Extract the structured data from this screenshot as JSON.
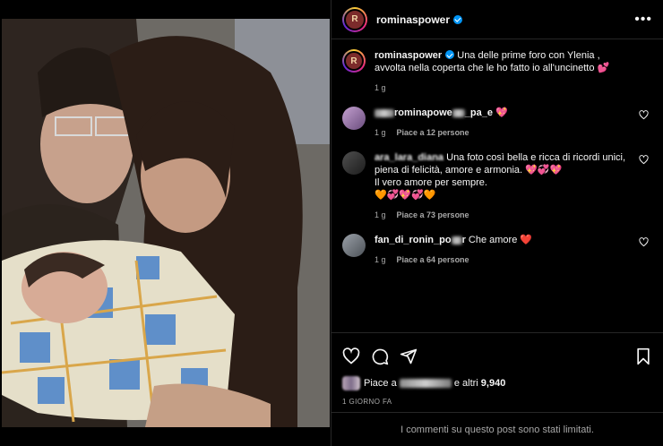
{
  "post": {
    "username": "rominaspower",
    "avatar_text": "R",
    "caption": "Una delle prime foro con Ylenia , avvolta nella coperta che le ho fatto io all'uncinetto 💕",
    "caption_time": "1 g"
  },
  "comments": [
    {
      "username_visible": "rominapowe",
      "username_tail": "_pa_e",
      "text": "💖",
      "time": "1 g",
      "likes": "Piace a 12 persone"
    },
    {
      "username_visible": "ara_lara_diana",
      "text": "Una foto così bella e ricca di ricordi unici, piena di felicità, amore e armonia. 💖💞💖\nIl vero amore per sempre.\n🧡💞💖💞🧡",
      "time": "1 g",
      "likes": "Piace a 73 persone"
    },
    {
      "username_visible": "fan_di_ronin_po",
      "username_tail": "r",
      "text": "Che amore ❤️",
      "time": "1 g",
      "likes": "Piace a 64 persone"
    }
  ],
  "likes_summary": {
    "prefix": "Piace a",
    "suffix": "e altri",
    "count": "9,940"
  },
  "date": "1 GIORNO FA",
  "limited_text": "I commenti su questo post sono stati limitati."
}
